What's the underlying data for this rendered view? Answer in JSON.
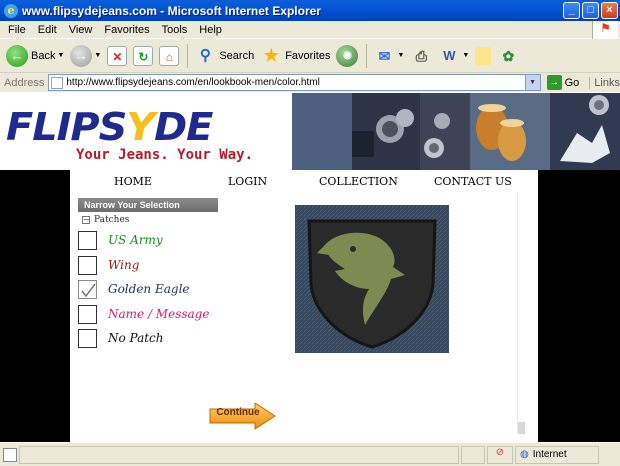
{
  "window": {
    "title": "www.flipsydejeans.com - Microsoft Internet Explorer",
    "minimize": "_",
    "maximize": "□",
    "close": "×"
  },
  "menu": {
    "items": [
      "File",
      "Edit",
      "View",
      "Favorites",
      "Tools",
      "Help"
    ]
  },
  "toolbar": {
    "back_label": "Back",
    "search_label": "Search",
    "favorites_label": "Favorites"
  },
  "addressbar": {
    "label": "Address",
    "url": "http://www.flipsydejeans.com/en/lookbook-men/color.html",
    "go_label": "Go",
    "links_label": "Links"
  },
  "site": {
    "logo_main": "FLIPS",
    "logo_y": "Y",
    "logo_end": "DE",
    "tagline": "Your Jeans. Your Way.",
    "nav": [
      "HOME",
      "LOGIN",
      "COLLECTION",
      "CONTACT US"
    ],
    "narrow_title": "Narrow Your Selection",
    "category": "Patches",
    "options": [
      {
        "label": "US Army",
        "checked": false,
        "color": "#1b8a1b"
      },
      {
        "label": "Wing",
        "checked": false,
        "color": "#8b1c1c"
      },
      {
        "label": "Golden Eagle",
        "checked": true,
        "color": "#2a2a6e"
      },
      {
        "label": "Name / Message",
        "checked": false,
        "color": "#d0207a"
      },
      {
        "label": "No Patch",
        "checked": false,
        "color": "#111111"
      }
    ],
    "continue_label": "Continue"
  },
  "status": {
    "zone": "Internet"
  }
}
